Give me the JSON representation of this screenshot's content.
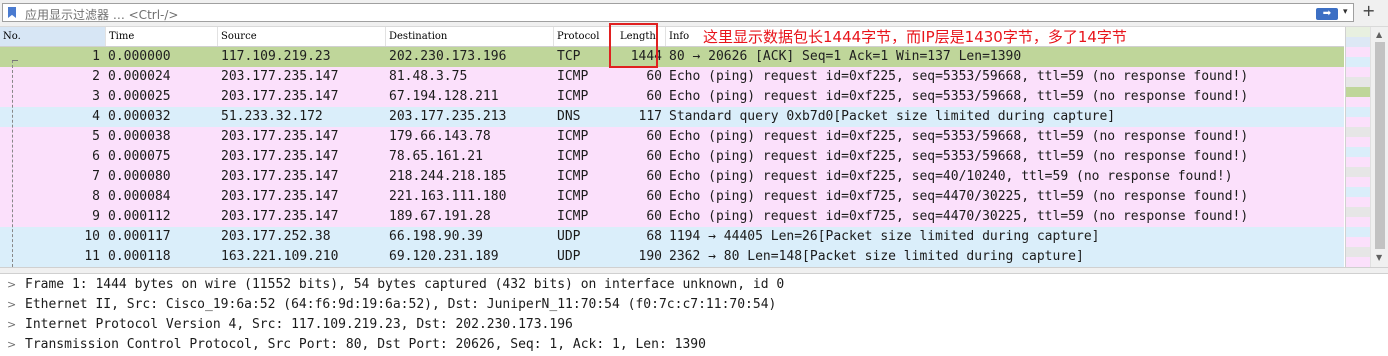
{
  "filter": {
    "placeholder": "应用显示过滤器 … <Ctrl-/>",
    "apply_symbol": "➡",
    "dropdown_symbol": "▾",
    "add_symbol": "+"
  },
  "columns": {
    "no": "No.",
    "time": "Time",
    "source": "Source",
    "destination": "Destination",
    "protocol": "Protocol",
    "length": "Length",
    "info": "Info"
  },
  "annotation": "这里显示数据包长1444字节，而IP层是1430字节，多了14字节",
  "packets": [
    {
      "no": "1",
      "time": "0.000000",
      "src": "117.109.219.23",
      "dst": "202.230.173.196",
      "proto": "TCP",
      "len": "1444",
      "info": "80 → 20626 [ACK] Seq=1 Ack=1 Win=137 Len=1390",
      "color": "#bfd69a"
    },
    {
      "no": "2",
      "time": "0.000024",
      "src": "203.177.235.147",
      "dst": "81.48.3.75",
      "proto": "ICMP",
      "len": "60",
      "info": "Echo (ping) request  id=0xf225, seq=5353/59668, ttl=59 (no response found!)",
      "color": "#fbe0fb"
    },
    {
      "no": "3",
      "time": "0.000025",
      "src": "203.177.235.147",
      "dst": "67.194.128.211",
      "proto": "ICMP",
      "len": "60",
      "info": "Echo (ping) request  id=0xf225, seq=5353/59668, ttl=59 (no response found!)",
      "color": "#fbe0fb"
    },
    {
      "no": "4",
      "time": "0.000032",
      "src": "51.233.32.172",
      "dst": "203.177.235.213",
      "proto": "DNS",
      "len": "117",
      "info": "Standard query 0xb7d0[Packet size limited during capture]",
      "color": "#daeefa"
    },
    {
      "no": "5",
      "time": "0.000038",
      "src": "203.177.235.147",
      "dst": "179.66.143.78",
      "proto": "ICMP",
      "len": "60",
      "info": "Echo (ping) request  id=0xf225, seq=5353/59668, ttl=59 (no response found!)",
      "color": "#fbe0fb"
    },
    {
      "no": "6",
      "time": "0.000075",
      "src": "203.177.235.147",
      "dst": "78.65.161.21",
      "proto": "ICMP",
      "len": "60",
      "info": "Echo (ping) request  id=0xf225, seq=5353/59668, ttl=59 (no response found!)",
      "color": "#fbe0fb"
    },
    {
      "no": "7",
      "time": "0.000080",
      "src": "203.177.235.147",
      "dst": "218.244.218.185",
      "proto": "ICMP",
      "len": "60",
      "info": "Echo (ping) request  id=0xf225, seq=40/10240, ttl=59 (no response found!)",
      "color": "#fbe0fb"
    },
    {
      "no": "8",
      "time": "0.000084",
      "src": "203.177.235.147",
      "dst": "221.163.111.180",
      "proto": "ICMP",
      "len": "60",
      "info": "Echo (ping) request  id=0xf725, seq=4470/30225, ttl=59 (no response found!)",
      "color": "#fbe0fb"
    },
    {
      "no": "9",
      "time": "0.000112",
      "src": "203.177.235.147",
      "dst": "189.67.191.28",
      "proto": "ICMP",
      "len": "60",
      "info": "Echo (ping) request  id=0xf725, seq=4470/30225, ttl=59 (no response found!)",
      "color": "#fbe0fb"
    },
    {
      "no": "10",
      "time": "0.000117",
      "src": "203.177.252.38",
      "dst": "66.198.90.39",
      "proto": "UDP",
      "len": "68",
      "info": "1194 → 44405 Len=26[Packet size limited during capture]",
      "color": "#daeefa"
    },
    {
      "no": "11",
      "time": "0.000118",
      "src": "163.221.109.210",
      "dst": "69.120.231.189",
      "proto": "UDP",
      "len": "190",
      "info": "2362 → 80 Len=148[Packet size limited during capture]",
      "color": "#daeefa"
    }
  ],
  "details": [
    {
      "arrow": ">",
      "text": "Frame 1: 1444 bytes on wire (11552 bits), 54 bytes captured (432 bits) on interface unknown, id 0"
    },
    {
      "arrow": ">",
      "text": "Ethernet II, Src: Cisco_19:6a:52 (64:f6:9d:19:6a:52), Dst: JuniperN_11:70:54 (f0:7c:c7:11:70:54)"
    },
    {
      "arrow": ">",
      "text": "Internet Protocol Version 4, Src: 117.109.219.23, Dst: 202.230.173.196"
    },
    {
      "arrow": ">",
      "text": "Transmission Control Protocol, Src Port: 80, Dst Port: 20626, Seq: 1, Ack: 1, Len: 1390"
    }
  ],
  "minimap_colors": [
    "#e8f0e0",
    "#dde8f5",
    "#fbe0fb",
    "#daeefa",
    "#fbe0fb",
    "#e6e6e6",
    "#bfd69a",
    "#fbe0fb",
    "#daeefa",
    "#fbe0fb",
    "#e6e6e6",
    "#fbe0fb",
    "#daeefa",
    "#fbe0fb",
    "#e6e6e6",
    "#fbe0fb",
    "#daeefa",
    "#fbe0fb",
    "#e6e6e6",
    "#fbe0fb",
    "#daeefa",
    "#fbe0fb",
    "#e6e6e6",
    "#fbe0fb"
  ]
}
